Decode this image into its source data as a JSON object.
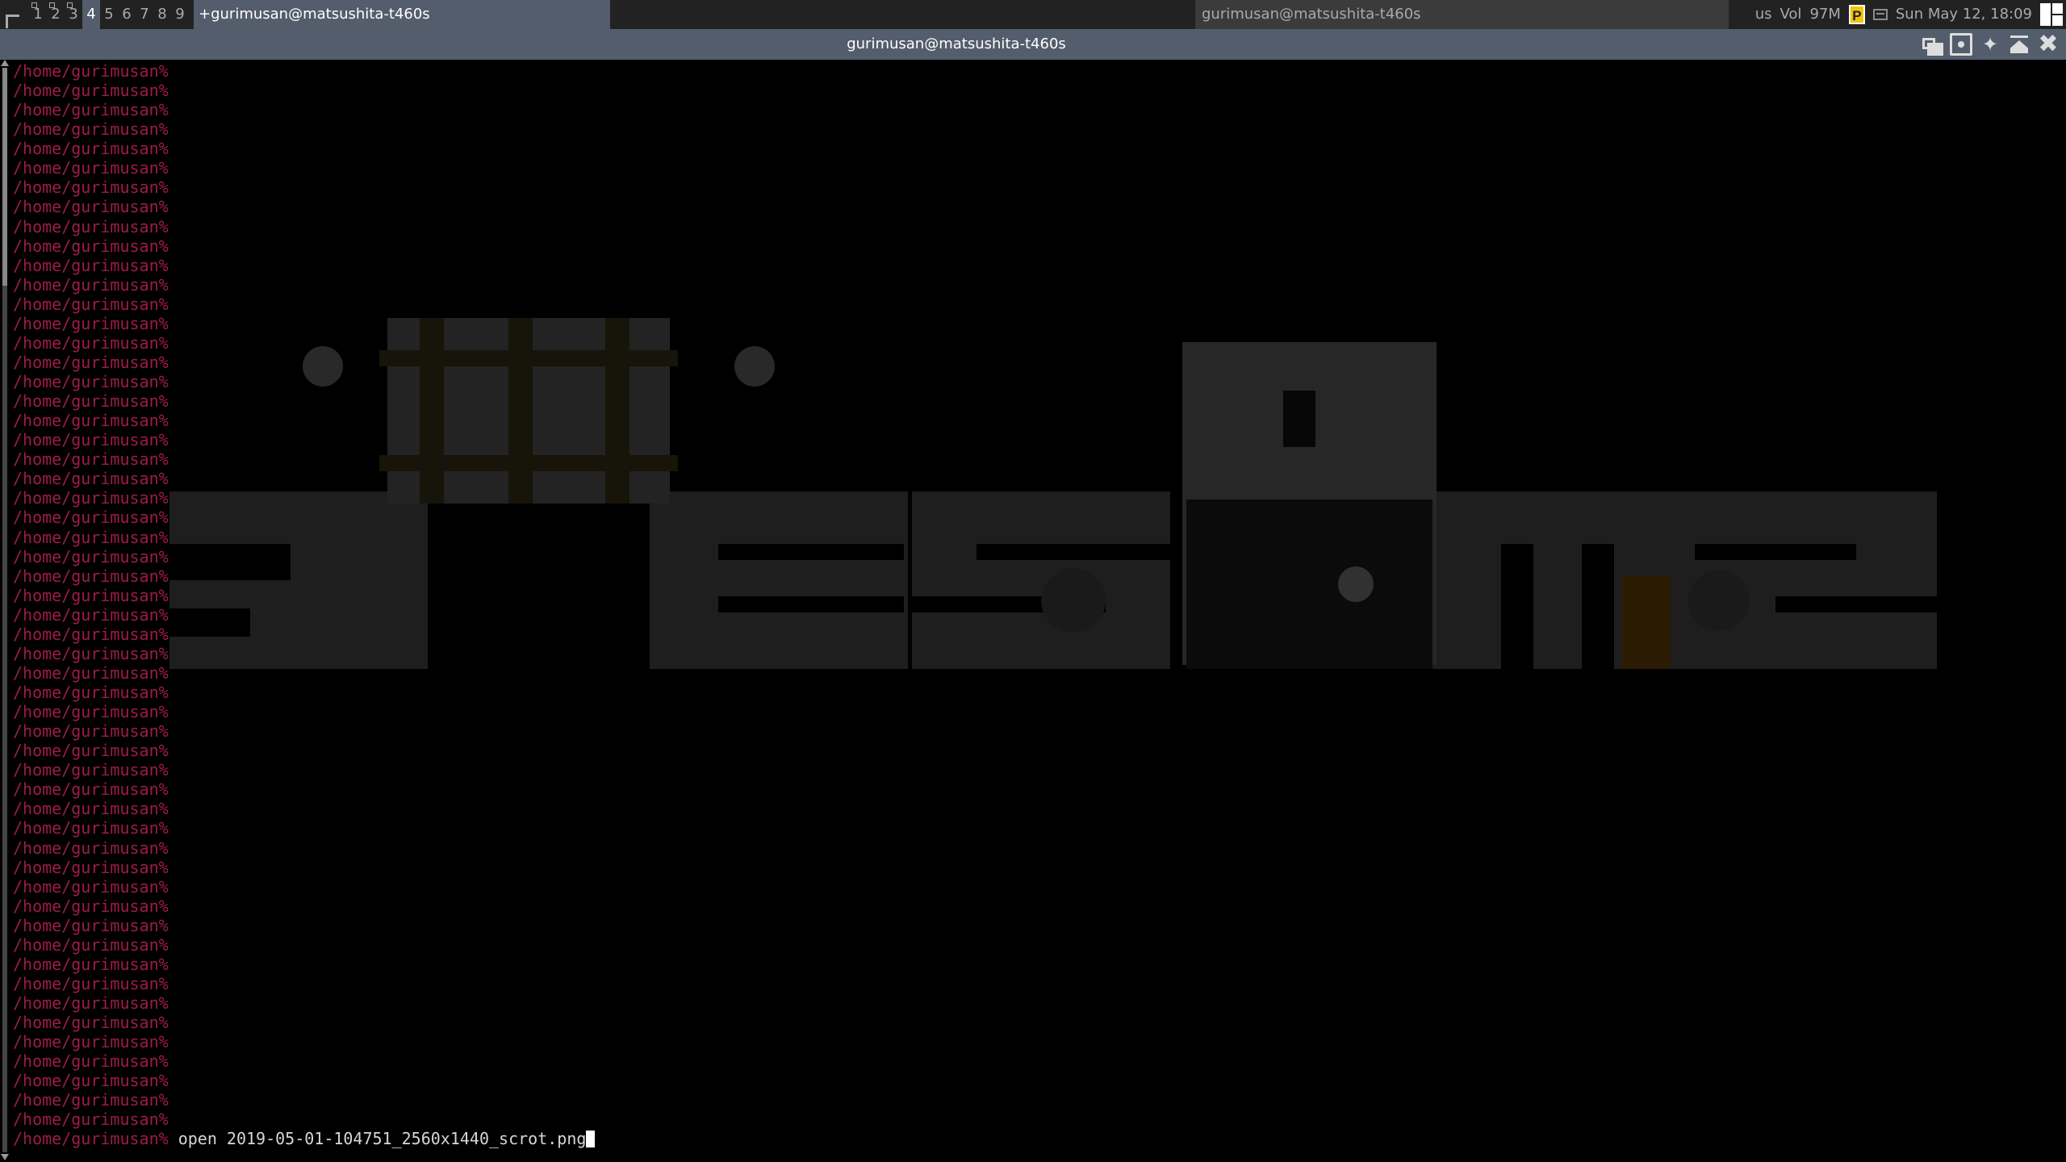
{
  "wibar": {
    "launcher_icon": "awesome-launcher-icon",
    "tags": [
      {
        "label": "1",
        "occupied": true,
        "focused": false
      },
      {
        "label": "2",
        "occupied": true,
        "focused": false
      },
      {
        "label": "3",
        "occupied": true,
        "focused": false
      },
      {
        "label": "4",
        "occupied": false,
        "focused": true
      },
      {
        "label": "5",
        "occupied": false,
        "focused": false
      },
      {
        "label": "6",
        "occupied": false,
        "focused": false
      },
      {
        "label": "7",
        "occupied": false,
        "focused": false
      },
      {
        "label": "8",
        "occupied": false,
        "focused": false
      },
      {
        "label": "9",
        "occupied": false,
        "focused": false
      }
    ],
    "focused_task": "+gurimusan@matsushita-t460s",
    "task_title": "gurimusan@matsushita-t460s",
    "keyboard_layout": "us",
    "volume": "Vol",
    "memory": "97M",
    "pomodoro_icon_letter": "P",
    "datetime": "Sun May 12, 18:09",
    "colors": {
      "bar_bg": "#222222",
      "focus_bg": "#535d6c",
      "fg": "#aaaaaa"
    }
  },
  "titlebar": {
    "title": "gurimusan@matsushita-t460s",
    "buttons": [
      "floating-button",
      "maximized-button",
      "sticky-button",
      "ontop-button",
      "close-button"
    ],
    "close_glyph": "✖",
    "sticky_glyph": "📌"
  },
  "terminal": {
    "prompt": "/home/gurimusan%",
    "prompt_color": "#9c1c47",
    "empty_prompt_count": 55,
    "last_command": " open 2019-05-01-104751_2560x1440_scrot.png"
  }
}
